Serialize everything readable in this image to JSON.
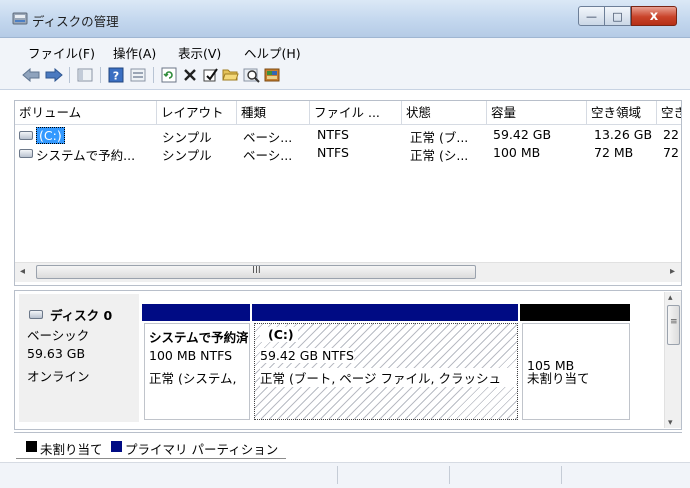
{
  "window": {
    "title": "ディスクの管理"
  },
  "caption_buttons": {
    "minimize": "—",
    "maximize": "□",
    "close": "x"
  },
  "menu": [
    "ファイル(F)",
    "操作(A)",
    "表示(V)",
    "ヘルプ(H)"
  ],
  "toolbar_icons": [
    "back-arrow-icon",
    "forward-arrow-icon",
    "console-tree-icon",
    "help-icon",
    "properties-icon",
    "refresh-icon",
    "delete-icon",
    "properties-check-icon",
    "open-folder-icon",
    "search-icon",
    "disk-settings-icon"
  ],
  "volumes": {
    "columns": [
      "ボリューム",
      "レイアウト",
      "種類",
      "ファイル ...",
      "状態",
      "容量",
      "空き領域",
      "空き"
    ],
    "rows": [
      [
        "(C:)",
        "シンプル",
        "ベーシ...",
        "NTFS",
        "正常 (ブ...",
        "59.42 GB",
        "13.26 GB",
        "22"
      ],
      [
        "システムで予約...",
        "シンプル",
        "ベーシ...",
        "NTFS",
        "正常 (シ...",
        "100 MB",
        "72 MB",
        "72"
      ]
    ]
  },
  "scrollbar": {
    "grip": "III",
    "left": "◂",
    "right": "▸"
  },
  "disk": {
    "name": "ディスク 0",
    "type": "ベーシック",
    "size": "59.63 GB",
    "status": "オンライン"
  },
  "partitions": [
    {
      "name": "システムで予約済",
      "detail": "100 MB NTFS",
      "status": "正常 (システム,",
      "bar_color": "#000b84"
    },
    {
      "name": "(C:)",
      "detail": "59.42 GB NTFS",
      "status": "正常 (ブート, ページ ファイル, クラッシュ",
      "bar_color": "#000b84"
    },
    {
      "name": "",
      "detail": "105 MB",
      "status": "未割り当て",
      "bar_color": "#000000"
    }
  ],
  "vscroll": {
    "up": "▴",
    "grip": "≡",
    "down": "▾"
  },
  "legend": [
    {
      "label": "未割り当て",
      "color": "#000000"
    },
    {
      "label": "プライマリ パーティション",
      "color": "#000b84"
    }
  ]
}
